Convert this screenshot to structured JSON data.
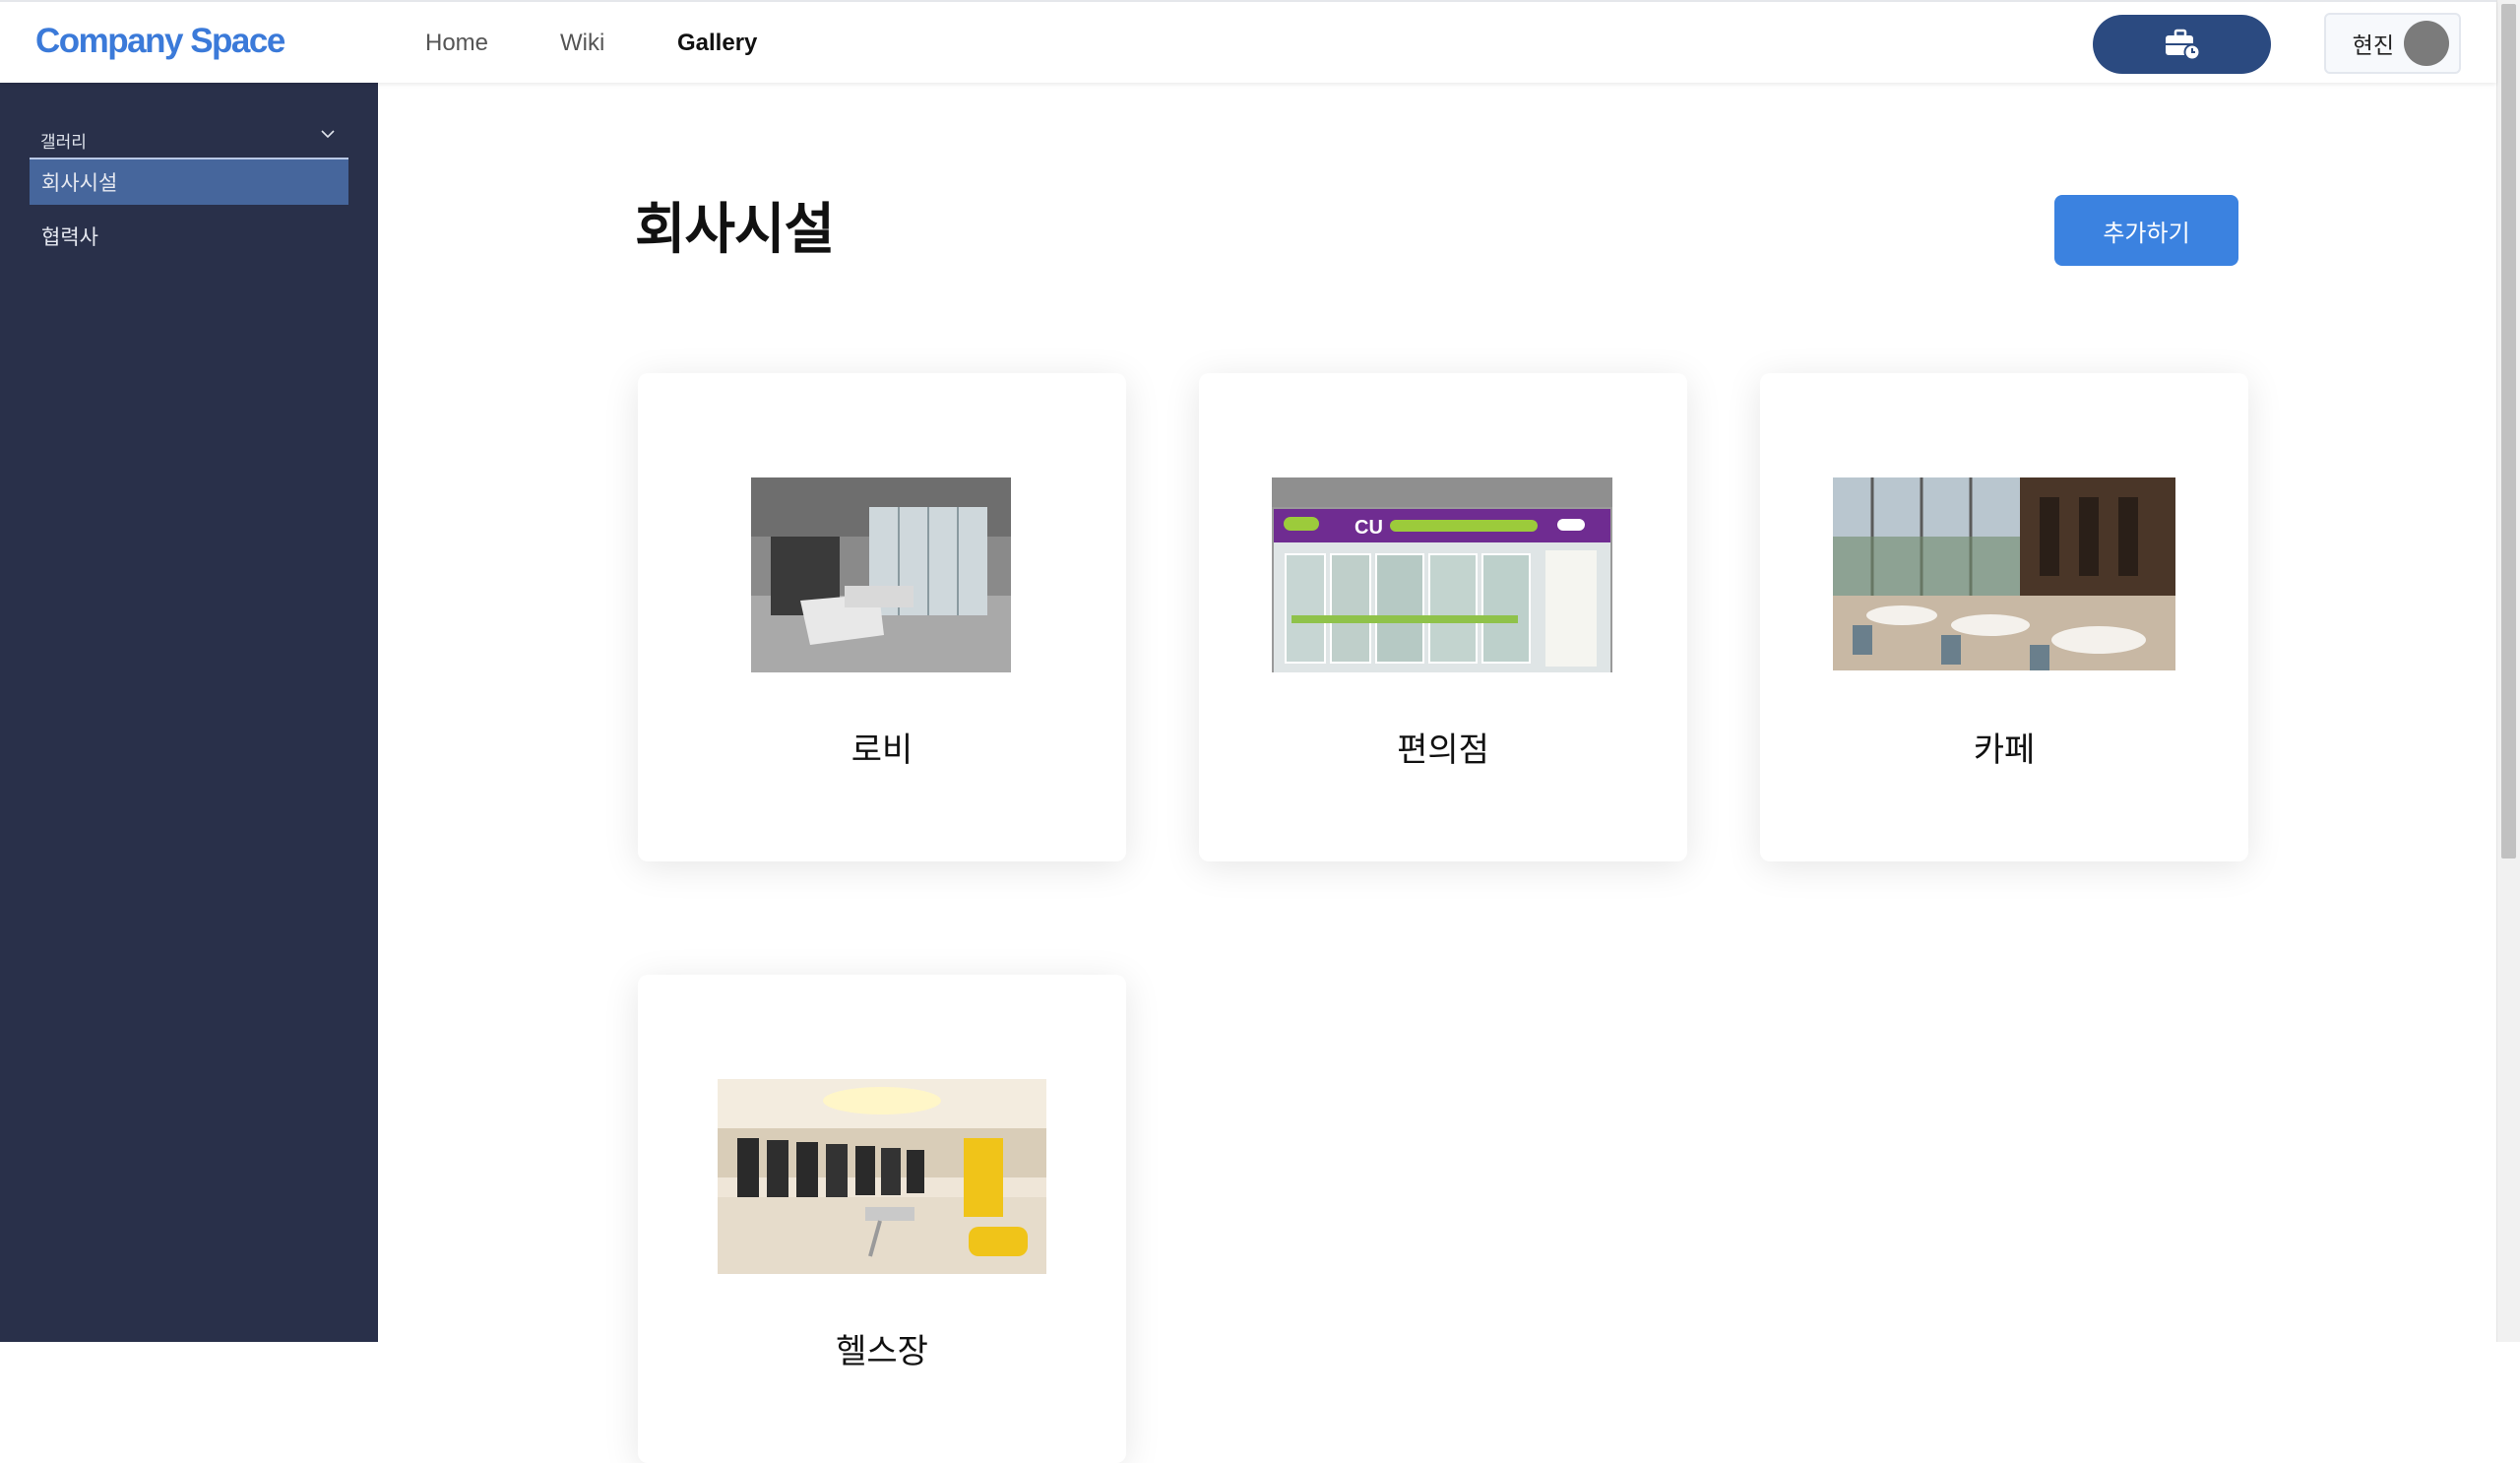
{
  "brand": {
    "logo": "Company Space"
  },
  "nav": {
    "home": "Home",
    "wiki": "Wiki",
    "gallery": "Gallery"
  },
  "user": {
    "name": "현진"
  },
  "sidebar": {
    "group_label": "갤러리",
    "items": [
      {
        "label": "회사시설"
      },
      {
        "label": "협력사"
      }
    ]
  },
  "main": {
    "title": "회사시설",
    "add_button": "추가하기",
    "cards": [
      {
        "label": "로비"
      },
      {
        "label": "편의점"
      },
      {
        "label": "카페"
      },
      {
        "label": "헬스장"
      }
    ]
  },
  "colors": {
    "brand": "#3b7ad9",
    "sidebar": "#29304a",
    "sidebar_active": "#46669c",
    "primary_button": "#3b82e0",
    "tool_button": "#2b4a80"
  }
}
